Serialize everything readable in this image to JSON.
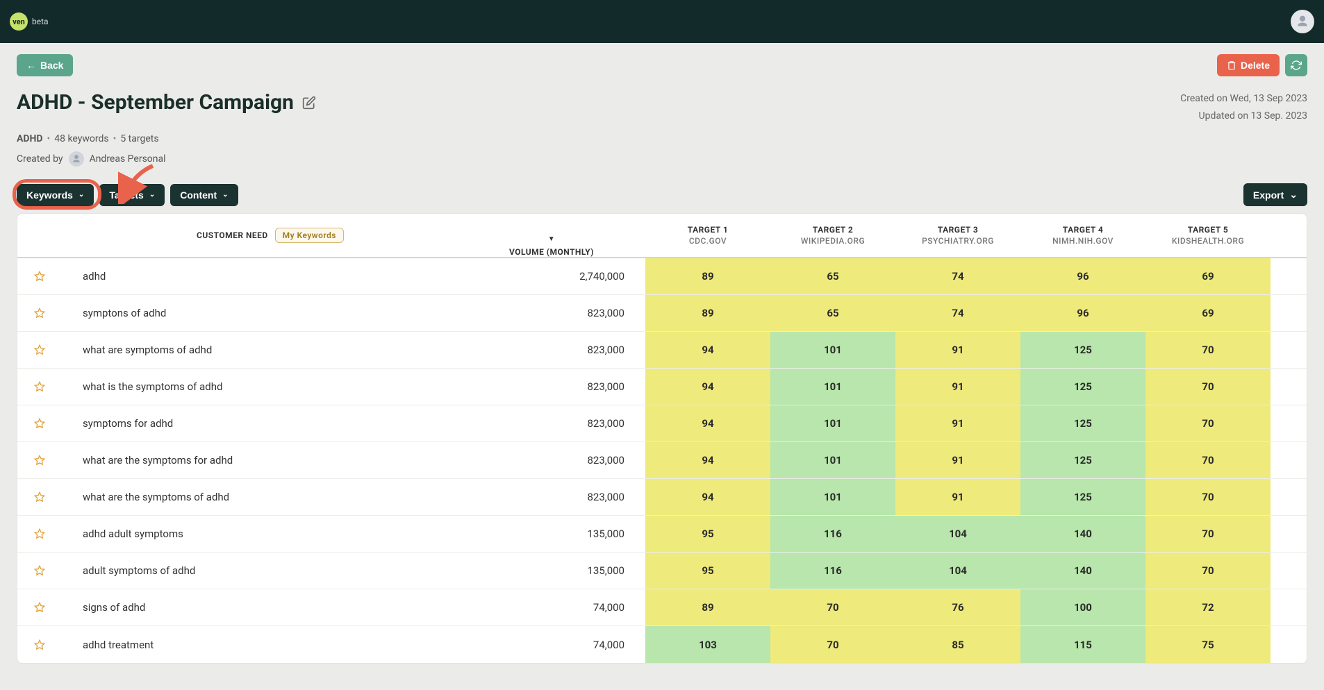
{
  "brand": {
    "logoText": "ven",
    "betaLabel": "beta"
  },
  "actions": {
    "back": "Back",
    "delete": "Delete",
    "export": "Export"
  },
  "page": {
    "title": "ADHD - September Campaign",
    "createdOn": "Created on Wed, 13 Sep 2023",
    "updatedOn": "Updated on 13 Sep. 2023",
    "topic": "ADHD",
    "keywordsCount": "48 keywords",
    "targetsCount": "5 targets",
    "createdByLabel": "Created by",
    "createdByName": "Andreas Personal"
  },
  "tabs": {
    "keywords": "Keywords",
    "targets": "Targets",
    "content": "Content"
  },
  "tableHeader": {
    "customerNeed": "CUSTOMER NEED",
    "badge": "My Keywords",
    "volume": "VOLUME (MONTHLY)"
  },
  "targets": [
    {
      "label": "TARGET 1",
      "domain": "CDC.GOV"
    },
    {
      "label": "TARGET 2",
      "domain": "WIKIPEDIA.ORG"
    },
    {
      "label": "TARGET 3",
      "domain": "PSYCHIATRY.ORG"
    },
    {
      "label": "TARGET 4",
      "domain": "NIMH.NIH.GOV"
    },
    {
      "label": "TARGET 5",
      "domain": "KIDSHEALTH.ORG"
    }
  ],
  "rows": [
    {
      "keyword": "adhd",
      "volume": "2,740,000",
      "scores": [
        {
          "v": "89",
          "c": "y"
        },
        {
          "v": "65",
          "c": "y"
        },
        {
          "v": "74",
          "c": "y"
        },
        {
          "v": "96",
          "c": "y"
        },
        {
          "v": "69",
          "c": "y"
        }
      ]
    },
    {
      "keyword": "symptons of adhd",
      "volume": "823,000",
      "scores": [
        {
          "v": "89",
          "c": "y"
        },
        {
          "v": "65",
          "c": "y"
        },
        {
          "v": "74",
          "c": "y"
        },
        {
          "v": "96",
          "c": "y"
        },
        {
          "v": "69",
          "c": "y"
        }
      ]
    },
    {
      "keyword": "what are symptoms of adhd",
      "volume": "823,000",
      "scores": [
        {
          "v": "94",
          "c": "y"
        },
        {
          "v": "101",
          "c": "g"
        },
        {
          "v": "91",
          "c": "y"
        },
        {
          "v": "125",
          "c": "g"
        },
        {
          "v": "70",
          "c": "y"
        }
      ]
    },
    {
      "keyword": "what is the symptoms of adhd",
      "volume": "823,000",
      "scores": [
        {
          "v": "94",
          "c": "y"
        },
        {
          "v": "101",
          "c": "g"
        },
        {
          "v": "91",
          "c": "y"
        },
        {
          "v": "125",
          "c": "g"
        },
        {
          "v": "70",
          "c": "y"
        }
      ]
    },
    {
      "keyword": "symptoms for adhd",
      "volume": "823,000",
      "scores": [
        {
          "v": "94",
          "c": "y"
        },
        {
          "v": "101",
          "c": "g"
        },
        {
          "v": "91",
          "c": "y"
        },
        {
          "v": "125",
          "c": "g"
        },
        {
          "v": "70",
          "c": "y"
        }
      ]
    },
    {
      "keyword": "what are the symptoms for adhd",
      "volume": "823,000",
      "scores": [
        {
          "v": "94",
          "c": "y"
        },
        {
          "v": "101",
          "c": "g"
        },
        {
          "v": "91",
          "c": "y"
        },
        {
          "v": "125",
          "c": "g"
        },
        {
          "v": "70",
          "c": "y"
        }
      ]
    },
    {
      "keyword": "what are the symptoms of adhd",
      "volume": "823,000",
      "scores": [
        {
          "v": "94",
          "c": "y"
        },
        {
          "v": "101",
          "c": "g"
        },
        {
          "v": "91",
          "c": "y"
        },
        {
          "v": "125",
          "c": "g"
        },
        {
          "v": "70",
          "c": "y"
        }
      ]
    },
    {
      "keyword": "adhd adult symptoms",
      "volume": "135,000",
      "scores": [
        {
          "v": "95",
          "c": "y"
        },
        {
          "v": "116",
          "c": "g"
        },
        {
          "v": "104",
          "c": "g"
        },
        {
          "v": "140",
          "c": "g"
        },
        {
          "v": "70",
          "c": "y"
        }
      ]
    },
    {
      "keyword": "adult symptoms of adhd",
      "volume": "135,000",
      "scores": [
        {
          "v": "95",
          "c": "y"
        },
        {
          "v": "116",
          "c": "g"
        },
        {
          "v": "104",
          "c": "g"
        },
        {
          "v": "140",
          "c": "g"
        },
        {
          "v": "70",
          "c": "y"
        }
      ]
    },
    {
      "keyword": "signs of adhd",
      "volume": "74,000",
      "scores": [
        {
          "v": "89",
          "c": "y"
        },
        {
          "v": "70",
          "c": "y"
        },
        {
          "v": "76",
          "c": "y"
        },
        {
          "v": "100",
          "c": "g"
        },
        {
          "v": "72",
          "c": "y"
        }
      ]
    },
    {
      "keyword": "adhd treatment",
      "volume": "74,000",
      "scores": [
        {
          "v": "103",
          "c": "g"
        },
        {
          "v": "70",
          "c": "y"
        },
        {
          "v": "85",
          "c": "y"
        },
        {
          "v": "115",
          "c": "g"
        },
        {
          "v": "75",
          "c": "y"
        }
      ]
    }
  ]
}
